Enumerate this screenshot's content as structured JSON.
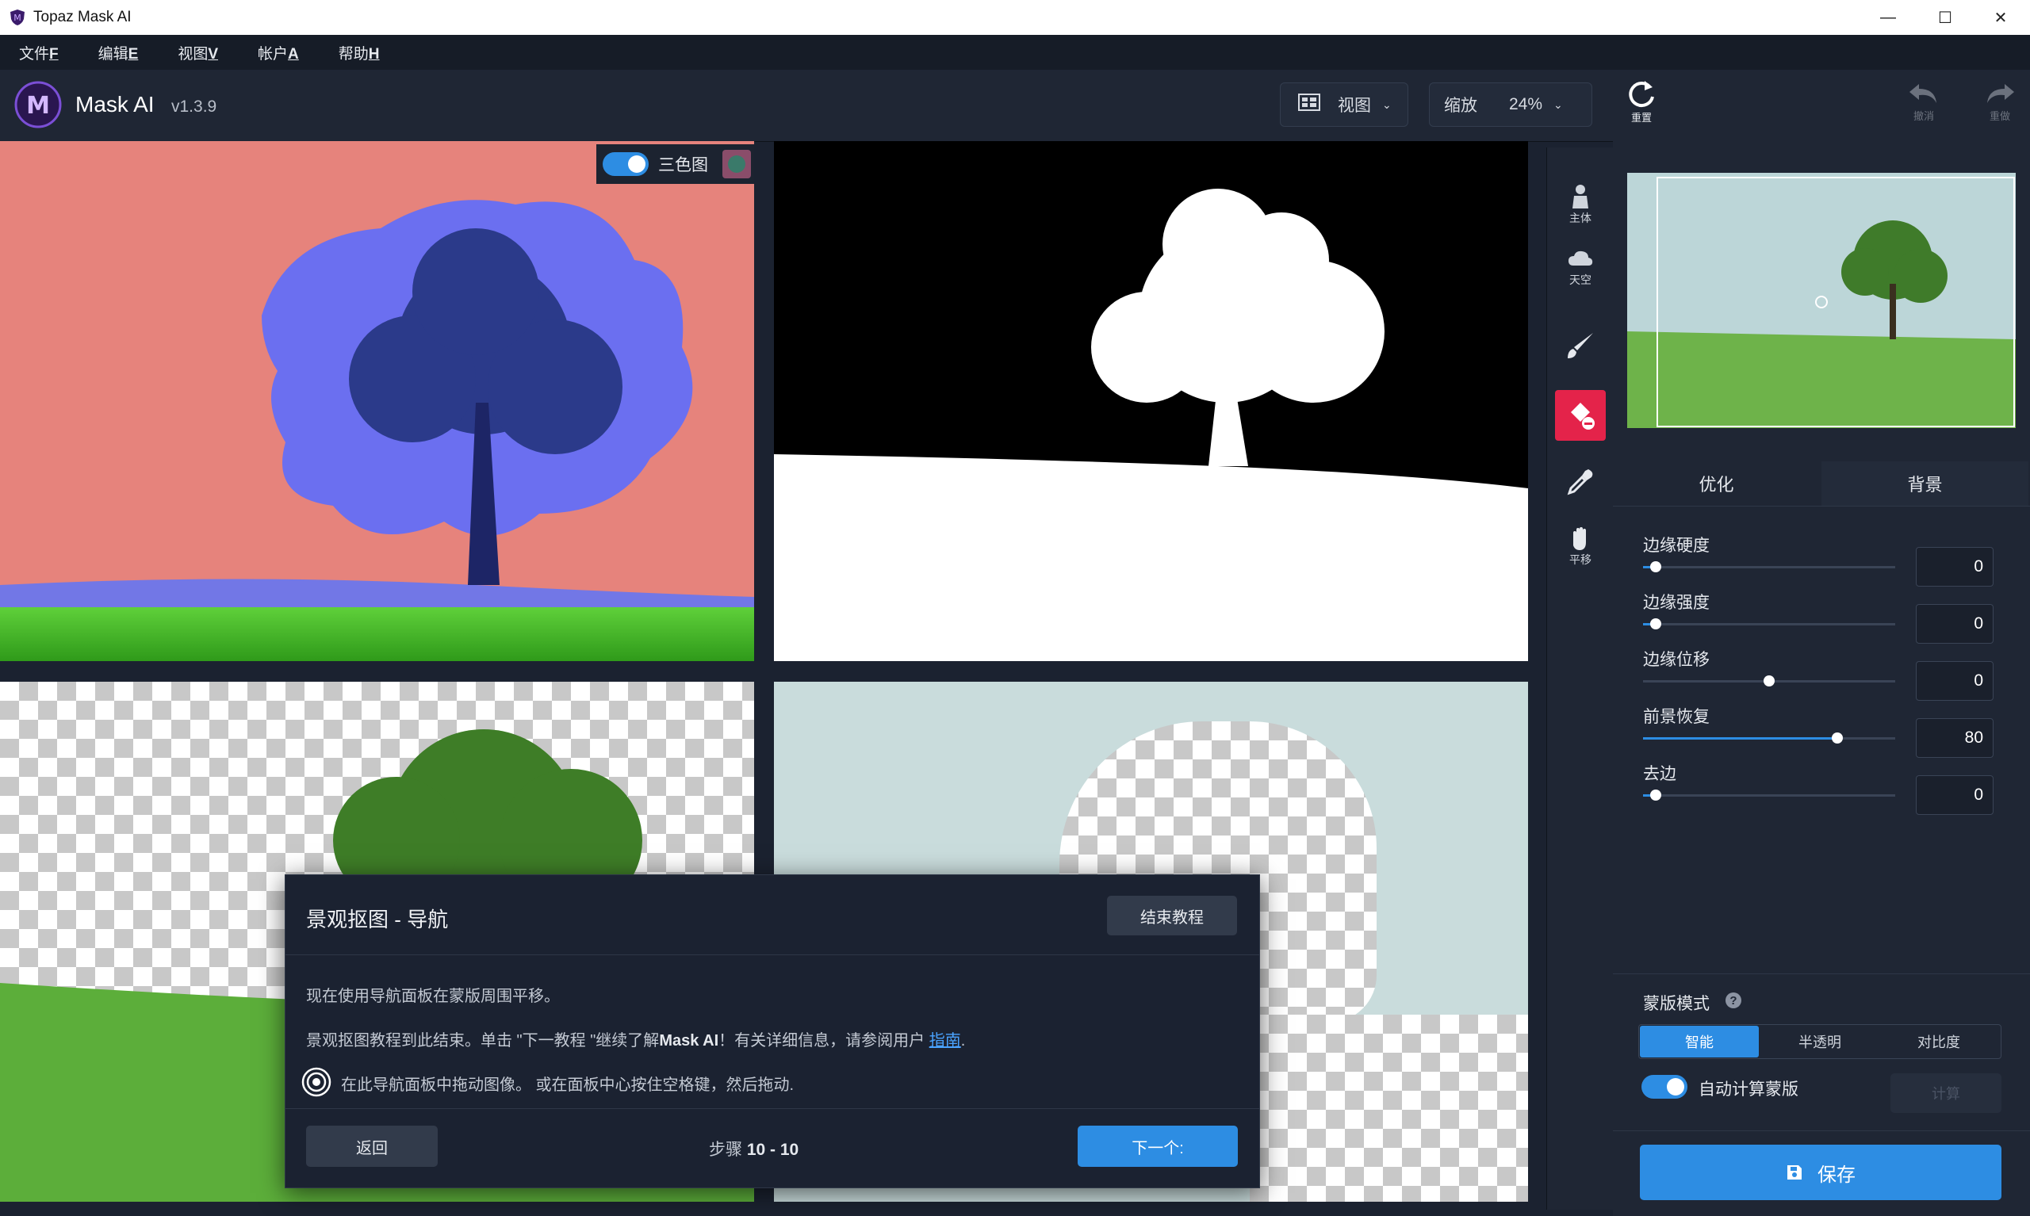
{
  "window": {
    "title": "Topaz Mask AI",
    "controls": [
      "—",
      "☐",
      "✕"
    ]
  },
  "menu": [
    {
      "text": "文件",
      "key": "F"
    },
    {
      "text": "编辑",
      "key": "E"
    },
    {
      "text": "视图",
      "key": "V"
    },
    {
      "text": "帐户",
      "key": "A"
    },
    {
      "text": "帮助",
      "key": "H"
    }
  ],
  "app": {
    "name": "Mask AI",
    "version": "v1.3.9",
    "logo_letter": "M"
  },
  "header": {
    "view_label": "视图",
    "zoom_label": "缩放",
    "zoom_value": "24%",
    "reset_label": "重置",
    "undo_label": "撤消",
    "redo_label": "重做"
  },
  "trimap": {
    "label": "三色图",
    "enabled": true
  },
  "tools": [
    {
      "name": "subject",
      "label": "主体",
      "icon": "person-icon"
    },
    {
      "name": "sky",
      "label": "天空",
      "icon": "cloud-icon"
    },
    {
      "name": "brush",
      "label": "",
      "icon": "brush-icon"
    },
    {
      "name": "fill",
      "label": "",
      "icon": "bucket-icon"
    },
    {
      "name": "eyedropper",
      "label": "",
      "icon": "eyedropper-icon"
    },
    {
      "name": "pan",
      "label": "平移",
      "icon": "hand-icon"
    }
  ],
  "panel": {
    "tabs": [
      "优化",
      "背景"
    ],
    "sliders": [
      {
        "label": "边缘硬度",
        "value": "0",
        "fraction": 0.05
      },
      {
        "label": "边缘强度",
        "value": "0",
        "fraction": 0.05
      },
      {
        "label": "边缘位移",
        "value": "0",
        "fraction": 0.5
      },
      {
        "label": "前景恢复",
        "value": "80",
        "fraction": 0.77
      },
      {
        "label": "去边",
        "value": "0",
        "fraction": 0.05
      }
    ],
    "mask_mode_label": "蒙版模式",
    "mask_modes": [
      "智能",
      "半透明",
      "对比度"
    ],
    "auto_compute_label": "自动计算蒙版",
    "compute_button": "计算",
    "save_button": "保存"
  },
  "tutorial": {
    "title": "景观抠图 - 导航",
    "end_button": "结束教程",
    "line1": "现在使用导航面板在蒙版周围平移。",
    "line2_pre": "景观抠图教程到此结束。单击 \"下一教程 \"继续了解",
    "line2_bold": "Mask AI",
    "line2_mid": "！有关详细信息，请参阅用户 ",
    "line2_link": "指南",
    "line2_end": ".",
    "hint": "在此导航面板中拖动图像。 或在面板中心按住空格键，然后拖动.",
    "back_button": "返回",
    "step_prefix": "步骤",
    "step_value": "10 - 10",
    "next_button": "下一个:"
  },
  "colors": {
    "accent": "#2d8de3",
    "active_tool": "#e4234a",
    "bg": "#1b2230"
  }
}
